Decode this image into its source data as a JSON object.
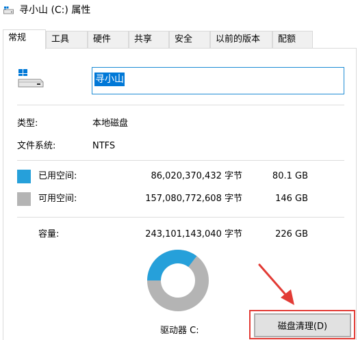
{
  "window": {
    "title": "寻小山 (C:) 属性"
  },
  "tabs": [
    {
      "label": "常规"
    },
    {
      "label": "工具"
    },
    {
      "label": "硬件"
    },
    {
      "label": "共享"
    },
    {
      "label": "安全"
    },
    {
      "label": "以前的版本"
    },
    {
      "label": "配额"
    }
  ],
  "drive": {
    "name": "寻小山"
  },
  "info": {
    "type_label": "类型:",
    "type_value": "本地磁盘",
    "fs_label": "文件系统:",
    "fs_value": "NTFS"
  },
  "usage": {
    "used_label": "已用空间:",
    "used_bytes": "86,020,370,432 字节",
    "used_size": "80.1 GB",
    "free_label": "可用空间:",
    "free_bytes": "157,080,772,608 字节",
    "free_size": "146 GB",
    "capacity_label": "容量:",
    "capacity_bytes": "243,101,143,040 字节",
    "capacity_size": "226 GB",
    "used_fraction": 0.354,
    "used_color": "#26a0da",
    "free_color": "#b4b4b4"
  },
  "drive_label": "驱动器 C:",
  "buttons": {
    "cleanup": "磁盘清理(D)"
  },
  "colors": {
    "annotation": "#e23b35",
    "selection": "#0078d7"
  }
}
